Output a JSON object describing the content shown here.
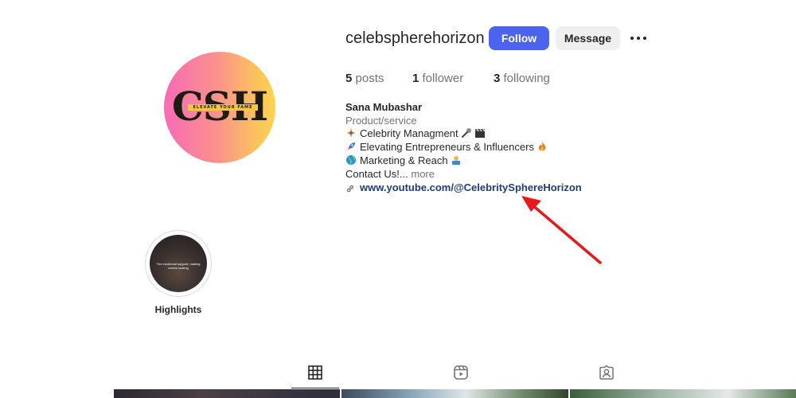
{
  "profile": {
    "username": "celebspherehorizon",
    "avatar_text": "CSH",
    "avatar_tagline": "ELEVATE YOUR FAME"
  },
  "actions": {
    "follow_label": "Follow",
    "message_label": "Message"
  },
  "stats": {
    "posts_count": "5",
    "posts_label": "posts",
    "followers_count": "1",
    "followers_label": "follower",
    "following_count": "3",
    "following_label": "following"
  },
  "bio": {
    "name": "Sana Mubashar",
    "category": "Product/service",
    "line1": "Celebrity Managment",
    "line2": "Elevating Entrepreneurs & Influencers",
    "line3": "Marketing & Reach",
    "line4": "Contact Us!...",
    "more_label": "more",
    "link": "www.youtube.com/@CelebritySphereHorizon"
  },
  "highlights": [
    {
      "label": "Highlights",
      "cover_text": "The emotional support, making covers looking"
    }
  ],
  "tabs": [
    {
      "name": "posts",
      "icon": "grid-icon",
      "active": true
    },
    {
      "name": "reels",
      "icon": "reels-icon",
      "active": false
    },
    {
      "name": "tagged",
      "icon": "tagged-icon",
      "active": false
    }
  ],
  "colors": {
    "follow_button": "#4c63f0",
    "annotation_arrow": "#e8191b",
    "link": "#1d3d7a"
  }
}
